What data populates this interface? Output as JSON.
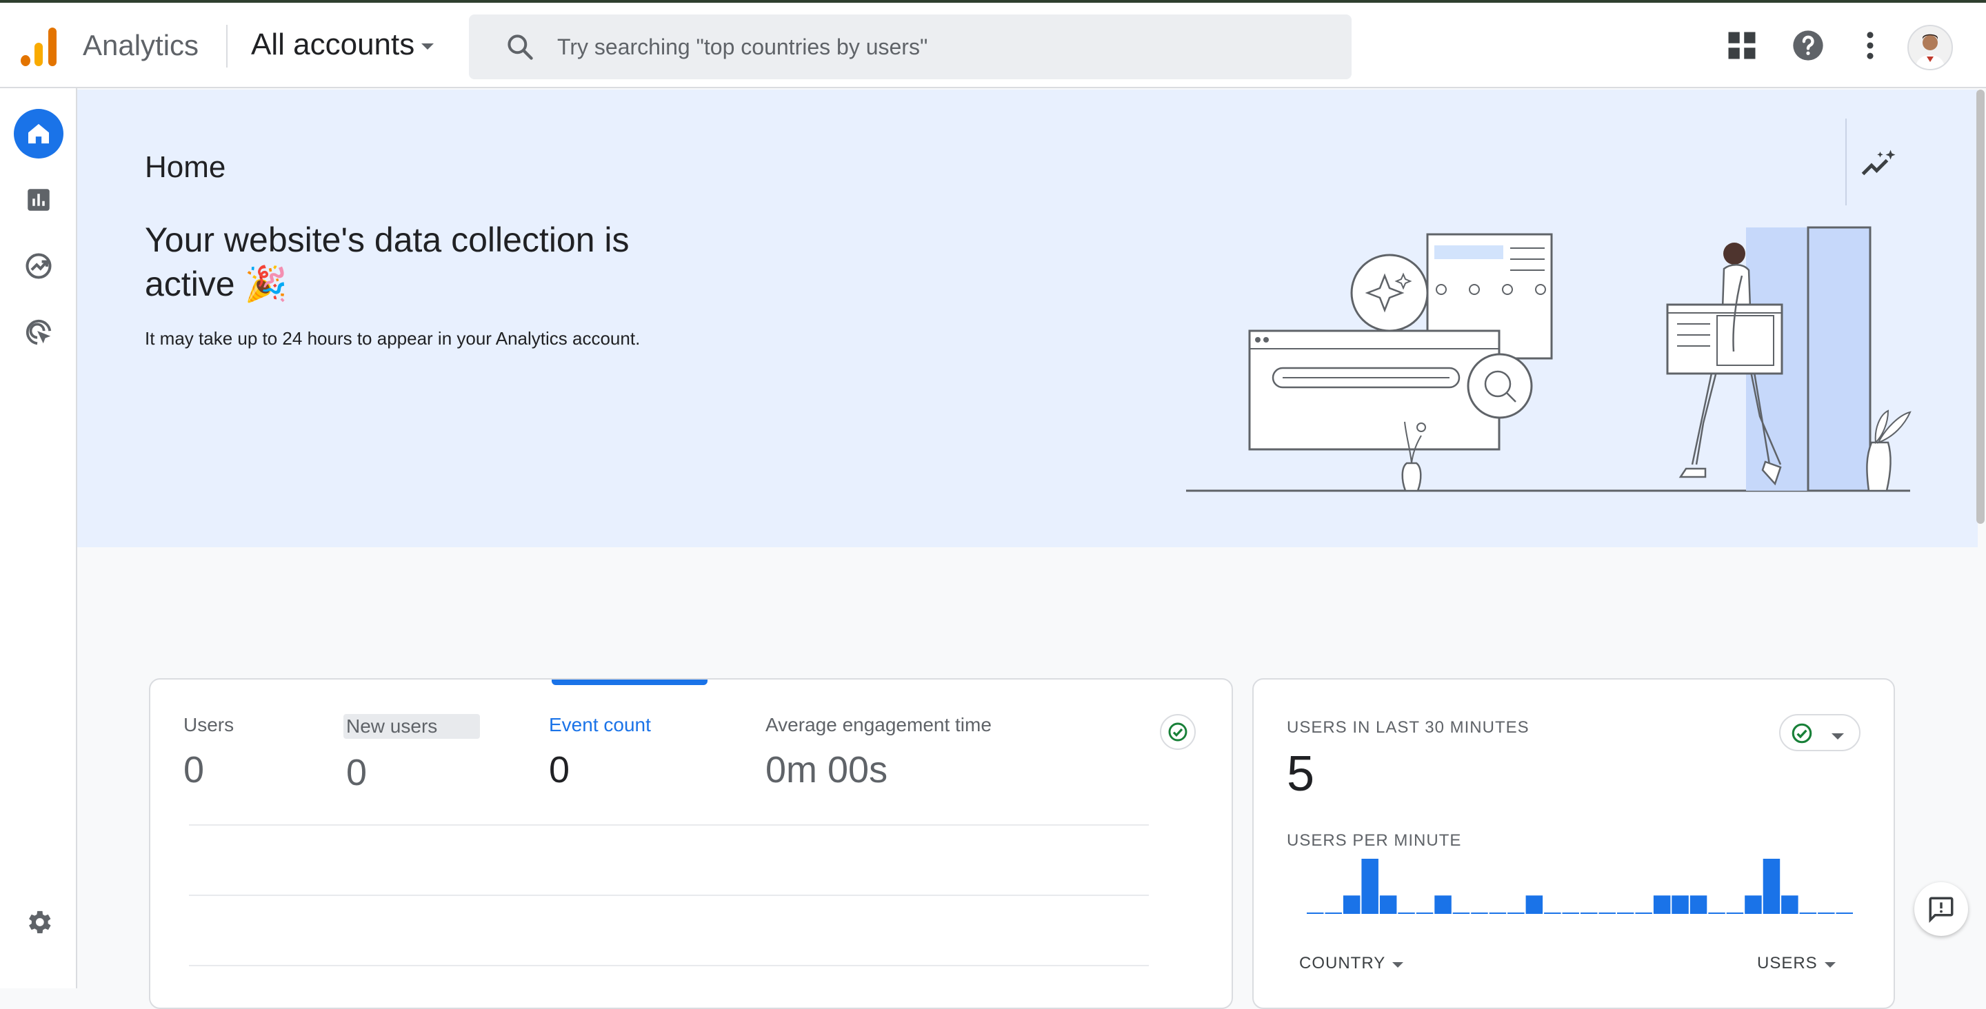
{
  "header": {
    "app_name": "Analytics",
    "account_label": "All accounts",
    "search_placeholder": "Try searching \"top countries by users\""
  },
  "sidebar": {
    "items": [
      {
        "name": "home",
        "icon": "home-icon",
        "active": true
      },
      {
        "name": "reports",
        "icon": "bar-chart-icon"
      },
      {
        "name": "explore",
        "icon": "explore-trend-icon"
      },
      {
        "name": "advertising",
        "icon": "advertising-target-icon"
      }
    ],
    "settings_icon": "gear-icon"
  },
  "hero": {
    "title": "Home",
    "headline": "Your website's data collection is active 🎉",
    "subtext": "It may take up to 24 hours to appear in your Analytics account."
  },
  "metrics": [
    {
      "label": "Users",
      "value": "0"
    },
    {
      "label": "New users",
      "value": "0"
    },
    {
      "label": "Event count",
      "value": "0"
    },
    {
      "label": "Average engagement time",
      "value": "0m 00s"
    }
  ],
  "realtime": {
    "title": "USERS IN LAST 30 MINUTES",
    "value": "5",
    "per_minute_label": "USERS PER MINUTE",
    "per_minute_values": [
      0,
      0,
      1,
      3,
      1,
      0,
      0,
      1,
      0,
      0,
      0,
      0,
      1,
      0,
      0,
      0,
      0,
      0,
      0,
      1,
      1,
      1,
      0,
      0,
      1,
      3,
      1,
      0,
      0,
      0
    ],
    "col_country": "COUNTRY",
    "col_users": "USERS"
  },
  "colors": {
    "accent": "#1a73e8",
    "hero_bg": "#e8f0fe",
    "check_green": "#188038",
    "logo_orange": "#e37400",
    "logo_yellow": "#f9ab00"
  }
}
